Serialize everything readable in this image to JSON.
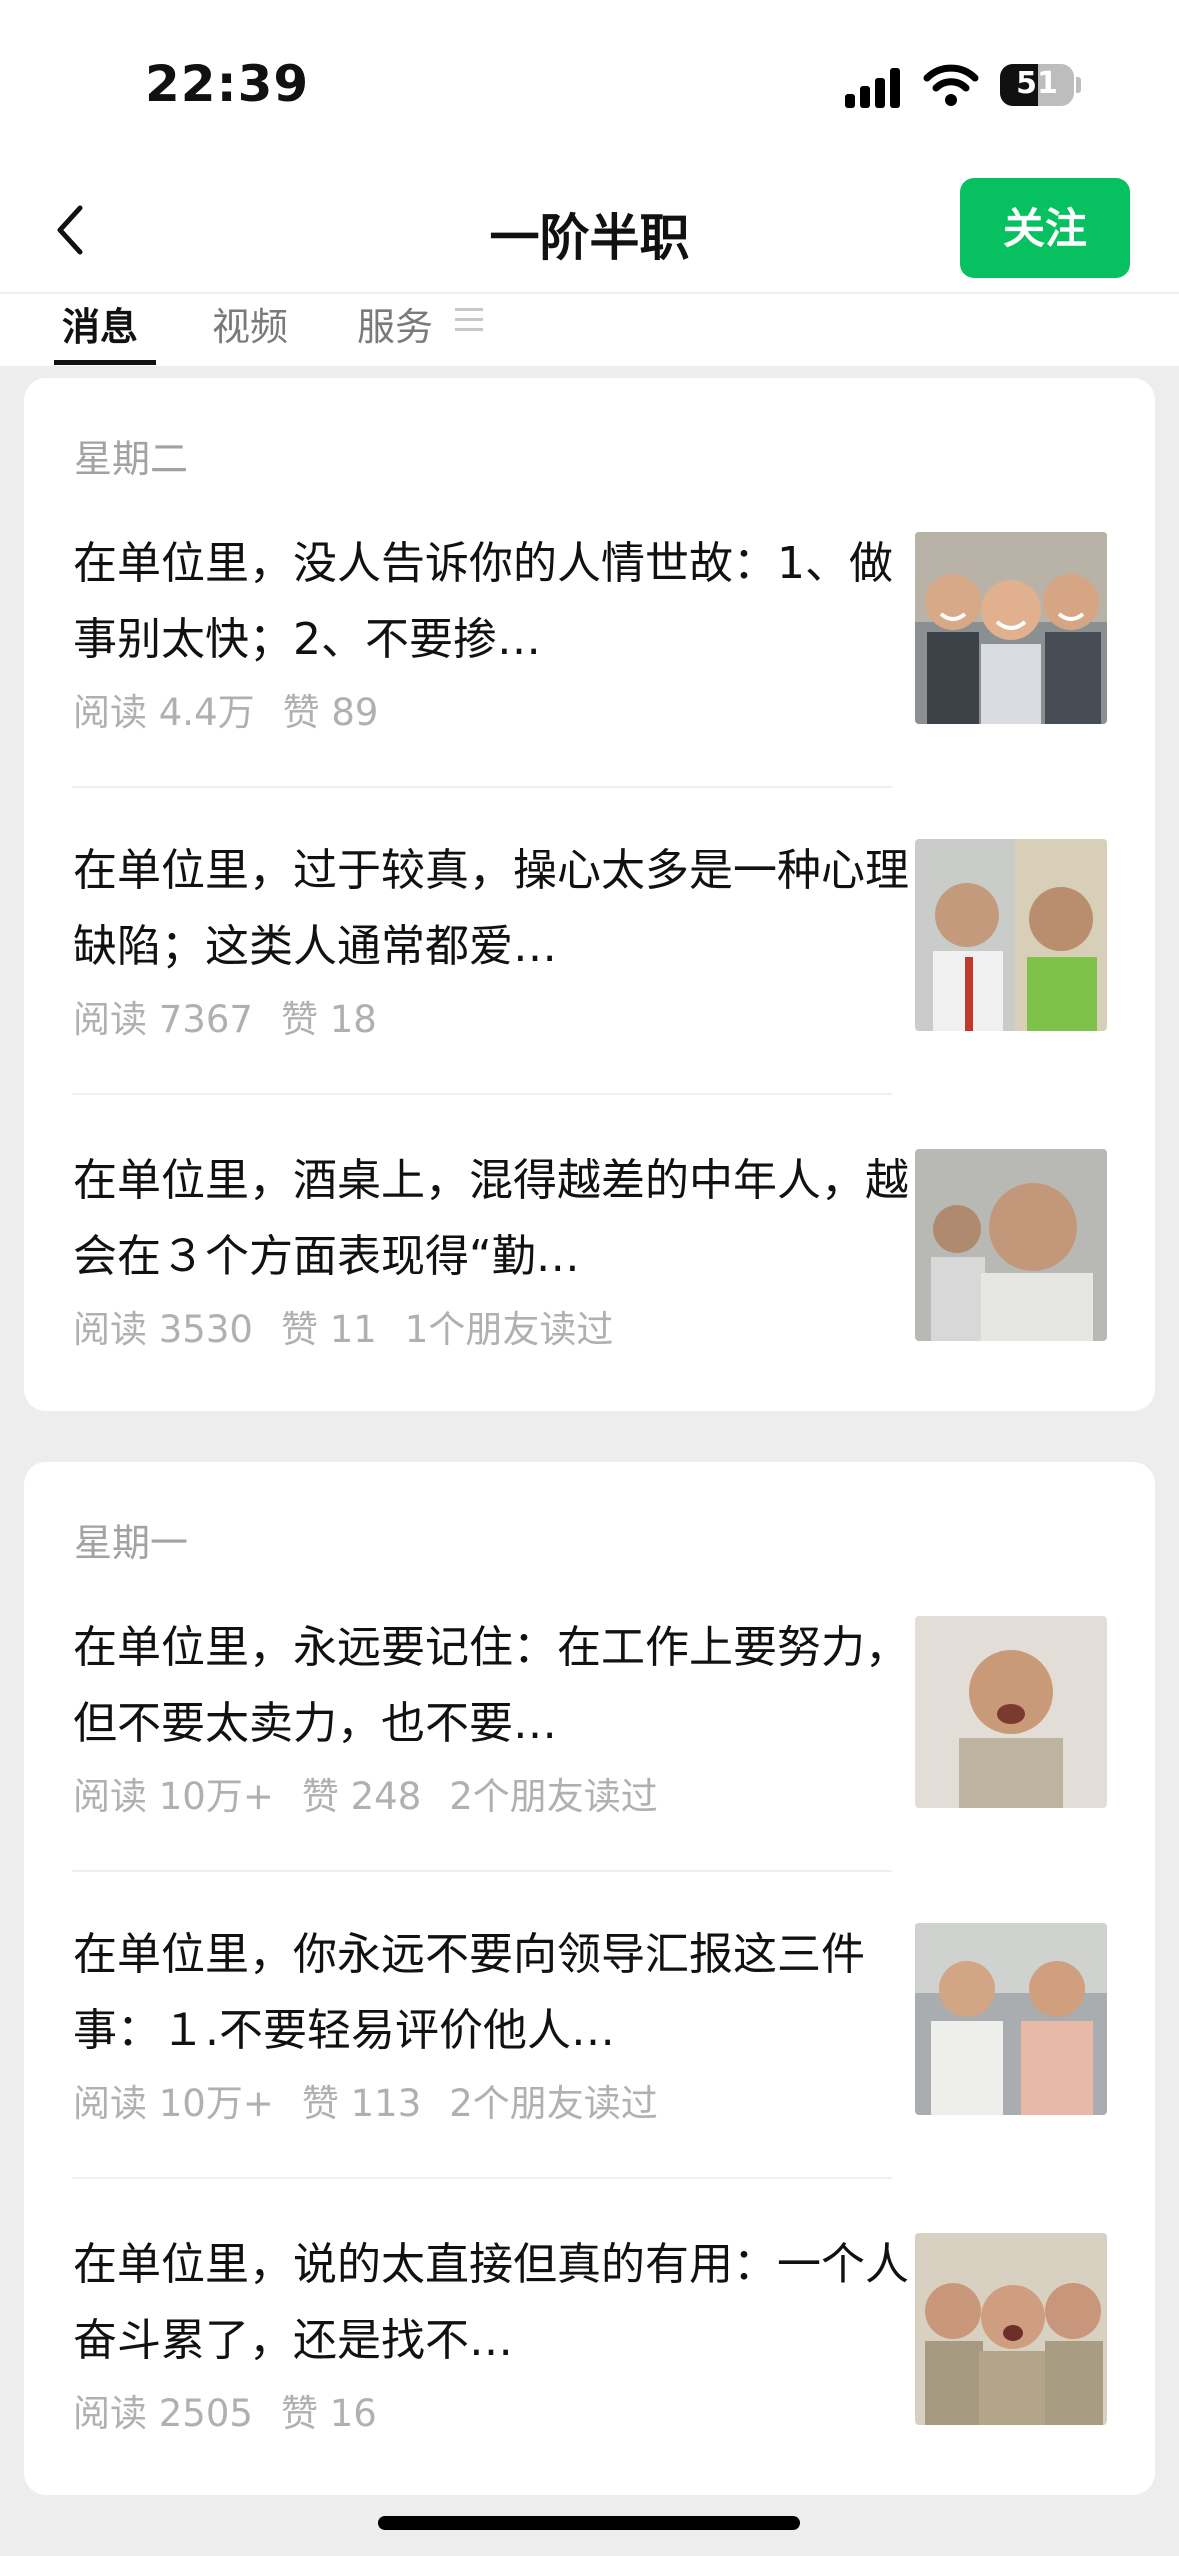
{
  "status_bar": {
    "time": "22:39",
    "battery": "51",
    "battery_level": 0.51
  },
  "nav": {
    "title": "一阶半职",
    "follow_label": "关注"
  },
  "tabs": [
    {
      "label": "消息",
      "active": true
    },
    {
      "label": "视频",
      "active": false
    },
    {
      "label": "服务",
      "active": false
    }
  ],
  "groups": [
    {
      "day": "星期二",
      "articles": [
        {
          "title": "在单位里，没人告诉你的人情世故：1、做事别太快；2、不要掺…",
          "reads": "阅读 4.4万",
          "likes": "赞 89",
          "friends": "",
          "thumb": "three-men-laughing"
        },
        {
          "title": "在单位里，过于较真，操心太多是一种心理缺陷；这类人通常都爱…",
          "reads": "阅读 7367",
          "likes": "赞 18",
          "friends": "",
          "thumb": "two-men-office"
        },
        {
          "title": "在单位里，酒桌上，混得越差的中年人，越会在３个方面表现得“勤…",
          "reads": "阅读 3530",
          "likes": "赞 11",
          "friends": "1个朋友读过",
          "thumb": "older-man-portrait"
        }
      ]
    },
    {
      "day": "星期一",
      "articles": [
        {
          "title": "在单位里，永远要记住：在工作上要努力，但不要太卖力，也不要…",
          "reads": "阅读 10万+",
          "likes": "赞 248",
          "friends": "2个朋友读过",
          "thumb": "crying-man"
        },
        {
          "title": "在单位里，你永远不要向领导汇报这三件事：１.不要轻易评价他人…",
          "reads": "阅读 10万+",
          "likes": "赞 113",
          "friends": "2个朋友读过",
          "thumb": "two-men-shirts"
        },
        {
          "title": "在单位里，说的太直接但真的有用：一个人奋斗累了，还是找不…",
          "reads": "阅读 2505",
          "likes": "赞 16",
          "friends": "",
          "thumb": "three-men-shouting"
        }
      ]
    }
  ]
}
